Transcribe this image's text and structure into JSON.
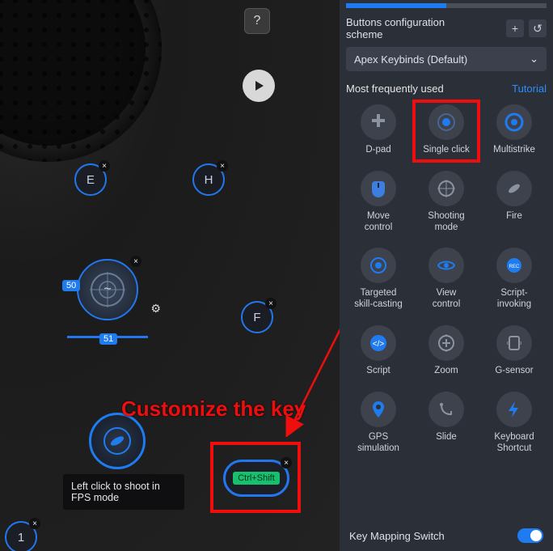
{
  "panel": {
    "scheme_label": "Buttons configuration scheme",
    "scheme_value": "Apex Keybinds (Default)",
    "most_used_label": "Most frequently used",
    "tutorial_label": "Tutorial",
    "switch_label": "Key Mapping Switch",
    "tiles": [
      {
        "label": "D-pad"
      },
      {
        "label": "Single click"
      },
      {
        "label": "Multistrike"
      },
      {
        "label": "Move\ncontrol"
      },
      {
        "label": "Shooting\nmode"
      },
      {
        "label": "Fire"
      },
      {
        "label": "Targeted\nskill-casting"
      },
      {
        "label": "View\ncontrol"
      },
      {
        "label": "Script-\ninvoking"
      },
      {
        "label": "Script"
      },
      {
        "label": "Zoom"
      },
      {
        "label": "G-sensor"
      },
      {
        "label": "GPS\nsimulation"
      },
      {
        "label": "Slide"
      },
      {
        "label": "Keyboard\nShortcut"
      }
    ]
  },
  "keys": {
    "e": "E",
    "h": "H",
    "f": "F",
    "one": "1",
    "tilde": "~",
    "sens_v": "50",
    "sens_h": "51",
    "chip": "Ctrl+Shift"
  },
  "tooltip": "Left click to shoot in FPS mode",
  "annotation": "Customize the key"
}
